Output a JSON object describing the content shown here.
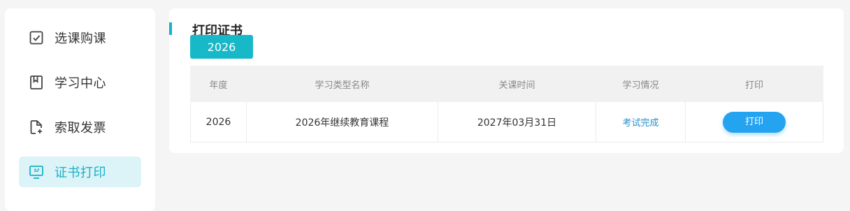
{
  "sidebar": {
    "items": [
      {
        "label": "选课购课",
        "icon": "checkbox-icon",
        "active": false
      },
      {
        "label": "学习中心",
        "icon": "bookmark-icon",
        "active": false
      },
      {
        "label": "索取发票",
        "icon": "file-add-icon",
        "active": false
      },
      {
        "label": "证书打印",
        "icon": "certificate-monitor-icon",
        "active": true
      }
    ]
  },
  "main": {
    "title": "打印证书",
    "year_tab": "2026",
    "table": {
      "headers": [
        "年度",
        "学习类型名称",
        "关课时间",
        "学习情况",
        "打印"
      ],
      "rows": [
        {
          "year": "2026",
          "type_name": "2026年继续教育课程",
          "close_time": "2027年03月31日",
          "status": "考试完成",
          "print_label": "打印"
        }
      ]
    }
  },
  "colors": {
    "accent": "#17b3c6",
    "active_bg": "#dcf3f8",
    "status_link": "#2a8fcb",
    "print_button": "#23a3f0"
  }
}
